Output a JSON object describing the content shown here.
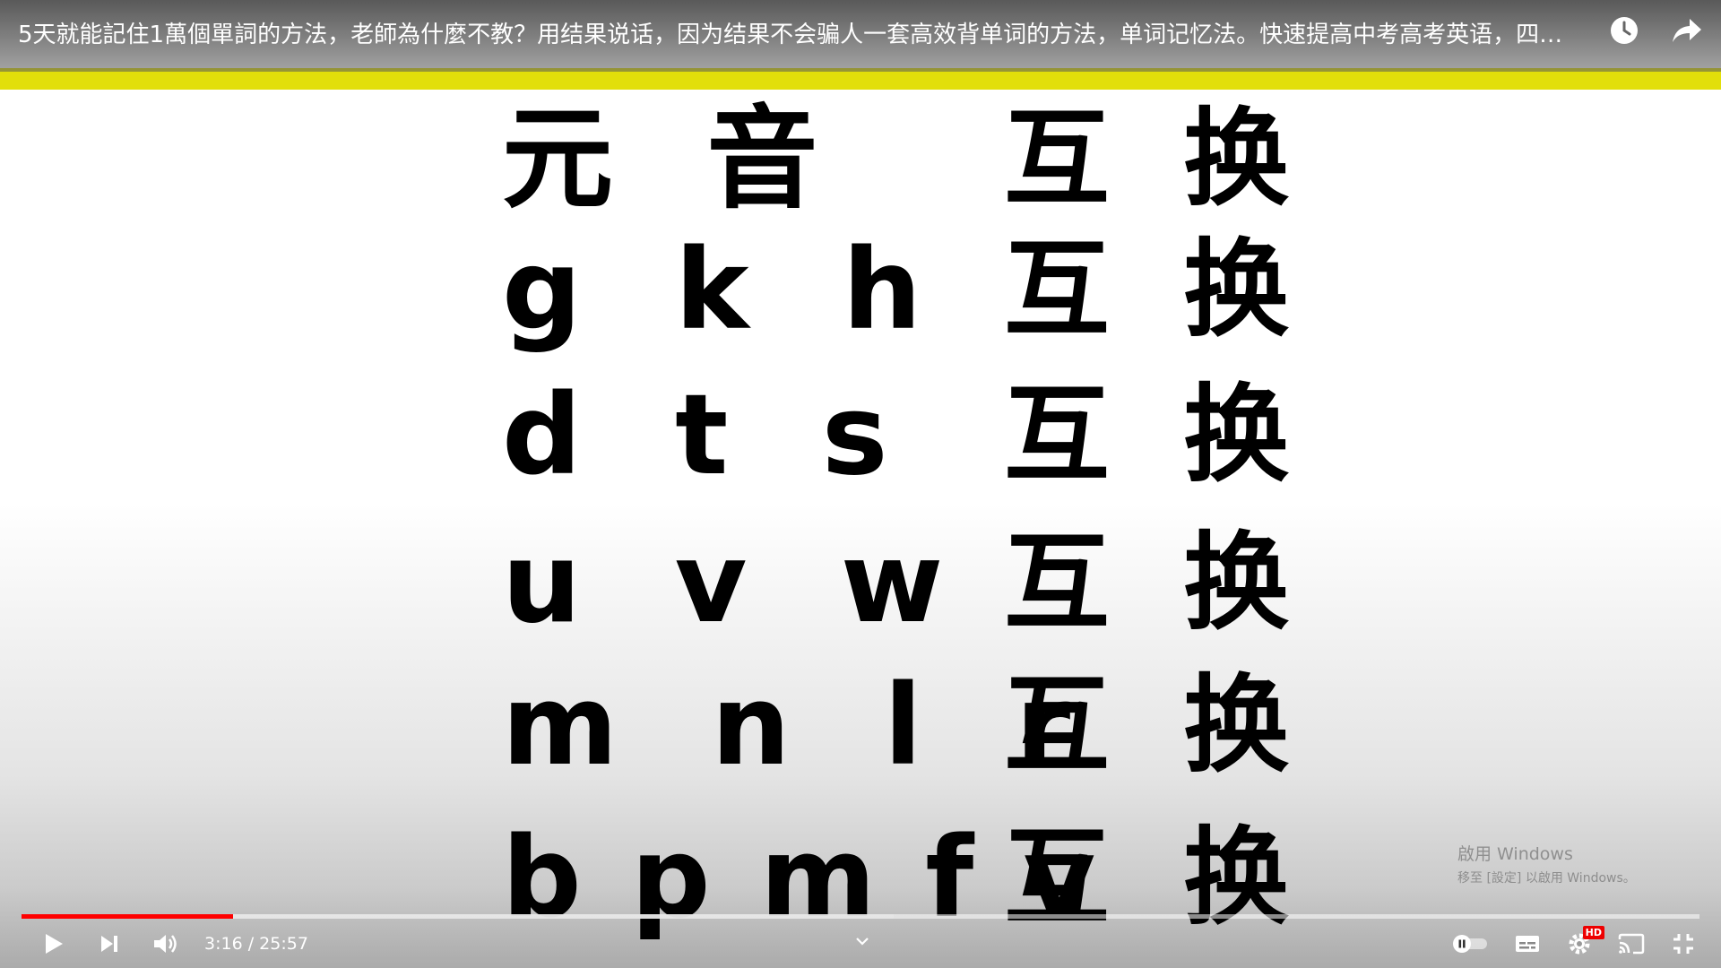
{
  "video": {
    "title": "5天就能記住1萬個單詞的方法，老師為什麼不教？用结果说话，因为结果不会骗人一套高效背单词的方法，单词记忆法。快速提高中考高考英语，四…"
  },
  "frame": {
    "rows": [
      {
        "left": "元  音",
        "right": "互  换"
      },
      {
        "left": "g  k  h",
        "right": "互  换"
      },
      {
        "left": "d  t  s",
        "right": "互  换"
      },
      {
        "left": "u  v  w",
        "right": "互  换"
      },
      {
        "left": "m  n  l  r",
        "right": "互  换"
      },
      {
        "left": "b p m f v",
        "right": "互  换"
      }
    ],
    "band_color": "#e2df0a"
  },
  "watermark": {
    "line1": "啟用 Windows",
    "line2": "移至 [設定] 以啟用 Windows。"
  },
  "controls": {
    "current_time": "3:16",
    "duration": "25:57",
    "time_text": "3:16 / 25:57",
    "progress_fraction": 0.126,
    "buffered_fraction": 0.52,
    "hd_badge": "HD",
    "progress_color": "#ff0000",
    "icons": {
      "top": [
        "watch-later-icon",
        "share-icon"
      ],
      "left": [
        "play-icon",
        "next-icon",
        "volume-icon"
      ],
      "right": [
        "autoplay-toggle-icon",
        "subtitles-icon",
        "settings-icon",
        "cast-icon",
        "exit-fullscreen-icon"
      ]
    }
  }
}
